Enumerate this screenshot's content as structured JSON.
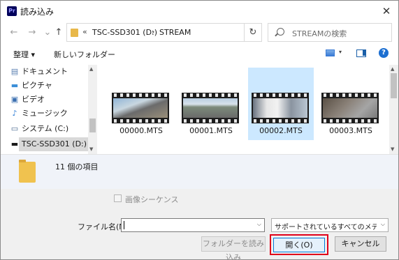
{
  "window": {
    "app_icon_text": "Pr",
    "title": "読み込み",
    "close_glyph": "✕"
  },
  "nav": {
    "back": "←",
    "forward": "→",
    "up": "↑",
    "address": {
      "overflow": "«",
      "drive": "TSC-SSD301 (D:)",
      "chevron": "›",
      "folder": "STREAM",
      "dropdown": "⌵"
    },
    "refresh": "↻",
    "search_placeholder": "STREAMの検索"
  },
  "toolbar": {
    "organize": "整理 ▾",
    "new_folder": "新しいフォルダー",
    "help": "?",
    "view_dropdown": "▾"
  },
  "sidebar": {
    "items": [
      {
        "label": "ドキュメント",
        "icon": "document-icon"
      },
      {
        "label": "ピクチャ",
        "icon": "pictures-icon"
      },
      {
        "label": "ビデオ",
        "icon": "video-icon"
      },
      {
        "label": "ミュージック",
        "icon": "music-icon"
      },
      {
        "label": "システム (C:)",
        "icon": "drive-icon"
      },
      {
        "label": "TSC-SSD301 (D:)",
        "icon": "drive-icon",
        "selected": true
      }
    ]
  },
  "files": [
    {
      "name": "00000.MTS",
      "selected": false
    },
    {
      "name": "00001.MTS",
      "selected": false
    },
    {
      "name": "00002.MTS",
      "selected": true
    },
    {
      "name": "00003.MTS",
      "selected": false
    }
  ],
  "details": {
    "item_count": "11 個の項目"
  },
  "bottom": {
    "image_sequence_label": "画像シーケンス",
    "image_sequence_checked": false,
    "filename_label": "ファイル名(N):",
    "filename_value": "",
    "file_type_filter": "サポートされているすべてのメディア (*",
    "import_folder_button": "フォルダーを読み込み",
    "open_button": "開く(O)",
    "cancel_button": "キャンセル"
  },
  "colors": {
    "accent": "#0078d7",
    "selection": "#cce8ff",
    "highlight_box": "#e0001a"
  }
}
